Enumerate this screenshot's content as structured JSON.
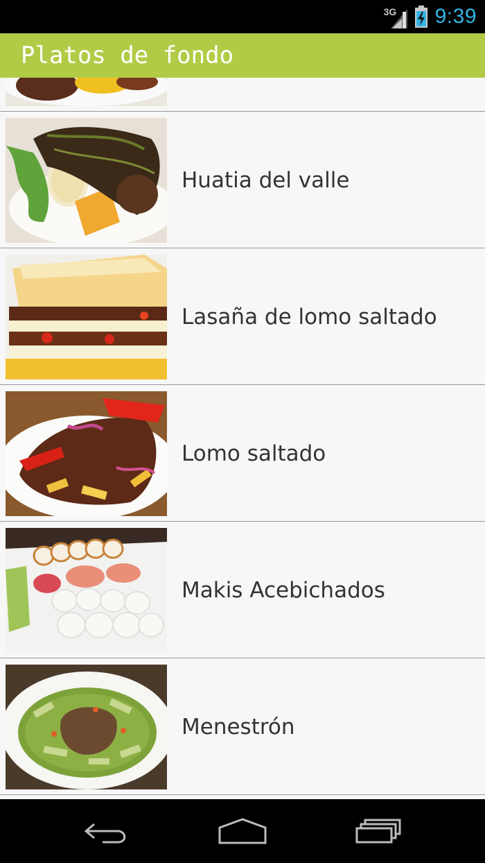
{
  "status_bar": {
    "network_type": "3G",
    "time": "9:39",
    "icons": [
      "signal-icon",
      "battery-charging-icon"
    ]
  },
  "action_bar": {
    "title": "Platos de fondo"
  },
  "colors": {
    "action_bar_bg": "#b2cb46",
    "clock": "#33b5e5",
    "list_bg": "#f7f7f7",
    "divider": "#999999",
    "text": "#333333"
  },
  "list": {
    "items": [
      {
        "label": "",
        "image": "dish-photo"
      },
      {
        "label": "Huatia del valle",
        "image": "dish-photo"
      },
      {
        "label": "Lasaña de lomo saltado",
        "image": "dish-photo"
      },
      {
        "label": "Lomo saltado",
        "image": "dish-photo"
      },
      {
        "label": "Makis Acebichados",
        "image": "dish-photo"
      },
      {
        "label": "Menestrón",
        "image": "dish-photo"
      }
    ]
  },
  "nav_bar": {
    "icons": [
      "back-icon",
      "home-icon",
      "recent-apps-icon"
    ]
  }
}
